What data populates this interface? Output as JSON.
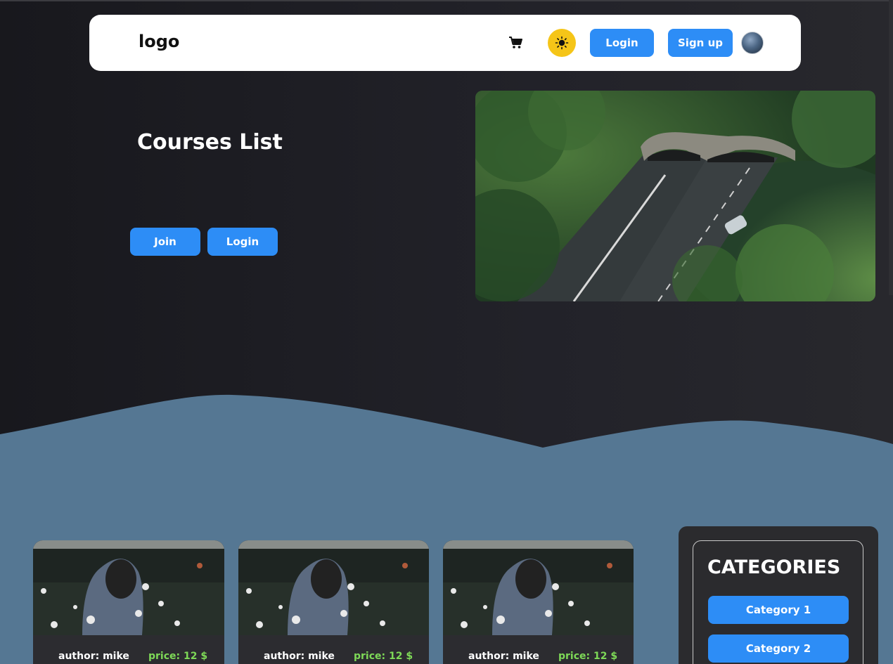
{
  "navbar": {
    "logo": "logo",
    "cart_icon": "cart-icon",
    "theme_icon": "sun-icon",
    "login_label": "Login",
    "signup_label": "Sign up"
  },
  "hero": {
    "title": "Courses List",
    "join_label": "Join",
    "login_label": "Login"
  },
  "courses": [
    {
      "author": "author: mike",
      "price": "price: 12 $"
    },
    {
      "author": "author: mike",
      "price": "price: 12 $"
    },
    {
      "author": "author: mike",
      "price": "price: 12 $"
    }
  ],
  "categories": {
    "title": "CATEGORIES",
    "items": [
      "Category 1",
      "Category 2"
    ]
  },
  "colors": {
    "accent": "#2d8df6",
    "theme_toggle": "#f5c518",
    "price": "#7ed957",
    "wave": "#557793",
    "background": "#1f1f25"
  }
}
